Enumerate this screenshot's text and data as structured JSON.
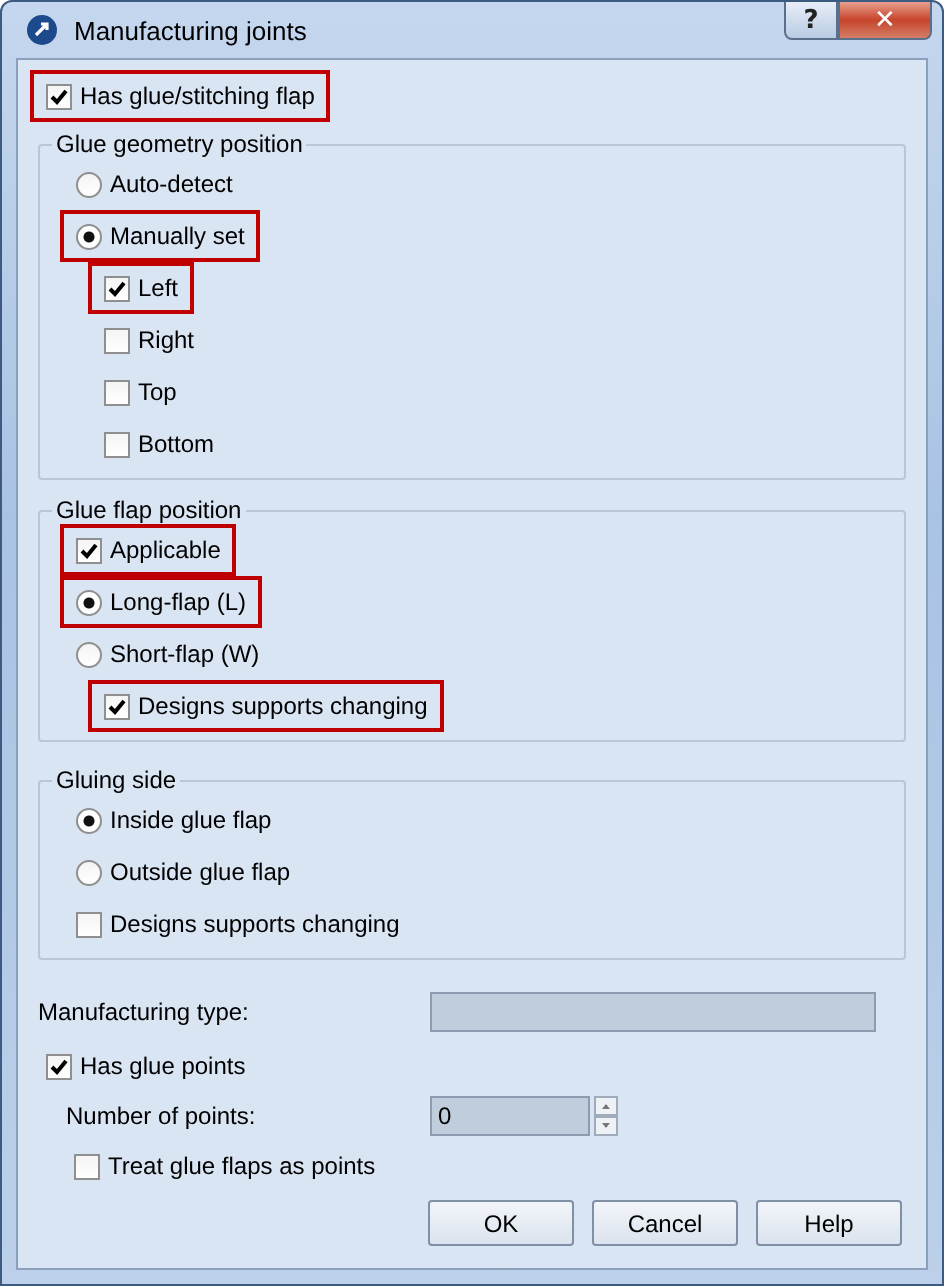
{
  "window": {
    "title": "Manufacturing joints",
    "help_button": "?",
    "close_button": "✕"
  },
  "main_option": {
    "kind": "checkbox",
    "label": "Has glue/stitching flap",
    "checked": true,
    "highlighted": true
  },
  "groups": [
    {
      "title": "Glue geometry position",
      "items": [
        {
          "kind": "radio",
          "label": "Auto-detect",
          "selected": false,
          "highlighted": false
        },
        {
          "kind": "radio",
          "label": "Manually set",
          "selected": true,
          "highlighted": true,
          "children": [
            {
              "kind": "checkbox",
              "label": "Left",
              "checked": true,
              "highlighted": true
            },
            {
              "kind": "checkbox",
              "label": "Right",
              "checked": false,
              "highlighted": false
            },
            {
              "kind": "checkbox",
              "label": "Top",
              "checked": false,
              "highlighted": false
            },
            {
              "kind": "checkbox",
              "label": "Bottom",
              "checked": false,
              "highlighted": false
            }
          ]
        }
      ]
    },
    {
      "title": "Glue flap position",
      "items": [
        {
          "kind": "checkbox",
          "label": "Applicable",
          "checked": true,
          "highlighted": true
        },
        {
          "kind": "radio",
          "label": "Long-flap (L)",
          "selected": true,
          "highlighted": true
        },
        {
          "kind": "radio",
          "label": "Short-flap (W)",
          "selected": false,
          "highlighted": false,
          "children": [
            {
              "kind": "checkbox",
              "label": "Designs supports changing",
              "checked": true,
              "highlighted": true
            }
          ]
        }
      ]
    },
    {
      "title": "Gluing side",
      "items": [
        {
          "kind": "radio",
          "label": "Inside glue flap",
          "selected": true,
          "highlighted": false
        },
        {
          "kind": "radio",
          "label": "Outside glue flap",
          "selected": false,
          "highlighted": false
        },
        {
          "kind": "checkbox",
          "label": "Designs supports changing",
          "checked": false,
          "highlighted": false
        }
      ]
    }
  ],
  "manufacturing_type": {
    "label": "Manufacturing type:",
    "disabled": true
  },
  "glue_points": {
    "kind": "checkbox",
    "label": "Has glue points",
    "checked": true,
    "highlighted": false,
    "number_label": "Number of points:",
    "number_value": "0",
    "number_disabled": true,
    "children": [
      {
        "kind": "checkbox",
        "label": "Treat glue flaps as points",
        "checked": false,
        "highlighted": false
      }
    ]
  },
  "buttons": [
    "OK",
    "Cancel",
    "Help"
  ]
}
